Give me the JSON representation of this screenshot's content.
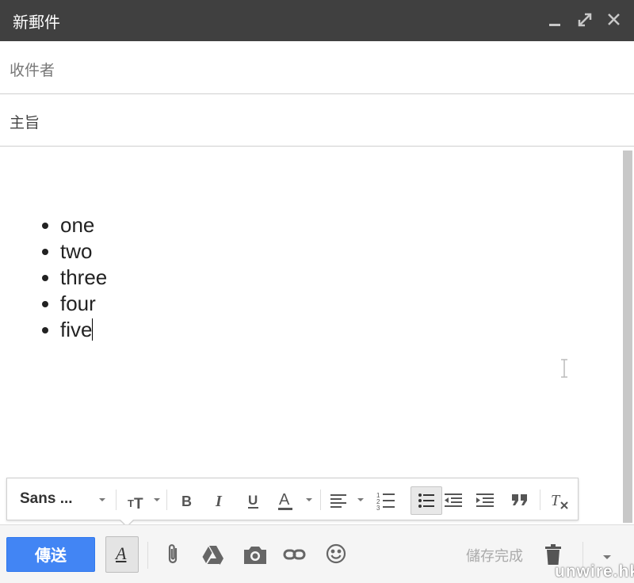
{
  "window": {
    "title": "新郵件"
  },
  "fields": {
    "to_placeholder": "收件者",
    "subject_placeholder": "主旨"
  },
  "body": {
    "items": [
      "one",
      "two",
      "three",
      "four",
      "five"
    ]
  },
  "format_toolbar": {
    "font_name": "Sans ...",
    "text_color_letter": "A"
  },
  "bottom_toolbar": {
    "send_label": "傳送",
    "format_toggle_letter": "A",
    "save_status": "儲存完成",
    "send_color": "#4285f4"
  },
  "watermark": "unwire.hk"
}
